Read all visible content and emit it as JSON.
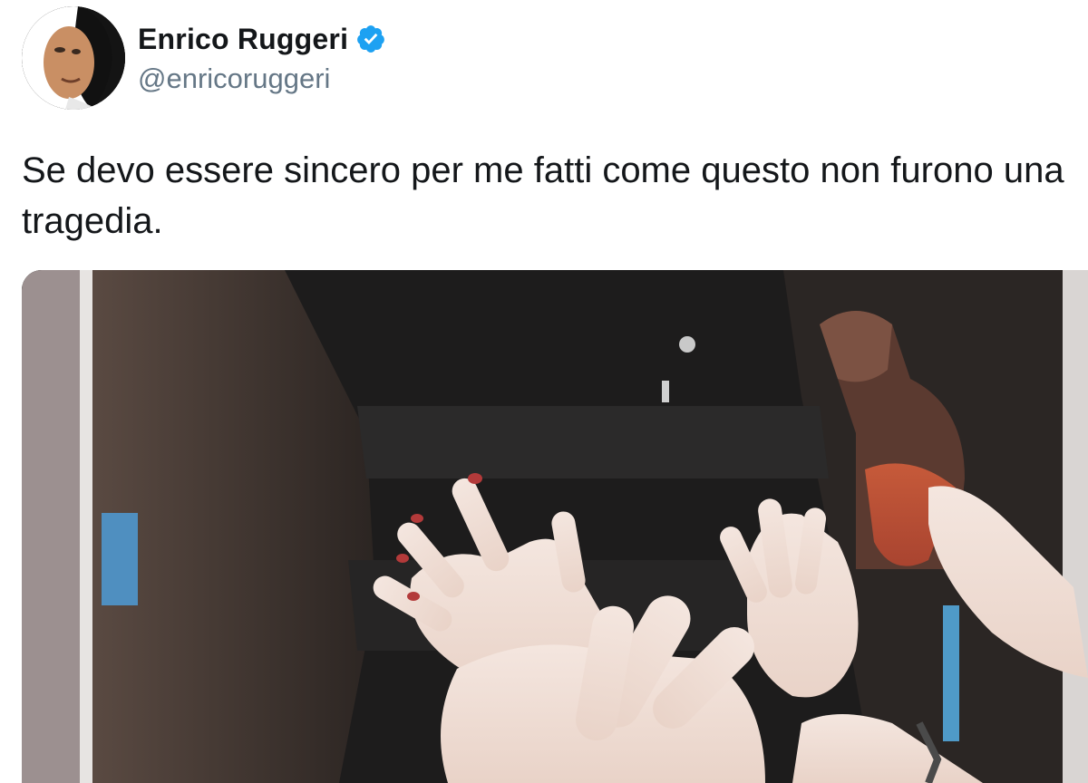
{
  "author": {
    "display_name": "Enrico Ruggeri",
    "handle": "@enricoruggeri",
    "verified": true
  },
  "tweet": {
    "text": "Se devo essere sincero per me fatti come questo non furono una tragedia."
  },
  "icons": {
    "verified": "verified-badge-icon"
  },
  "colors": {
    "verified_blue": "#1da1f2",
    "text_primary": "#14171a",
    "text_secondary": "#657786"
  }
}
